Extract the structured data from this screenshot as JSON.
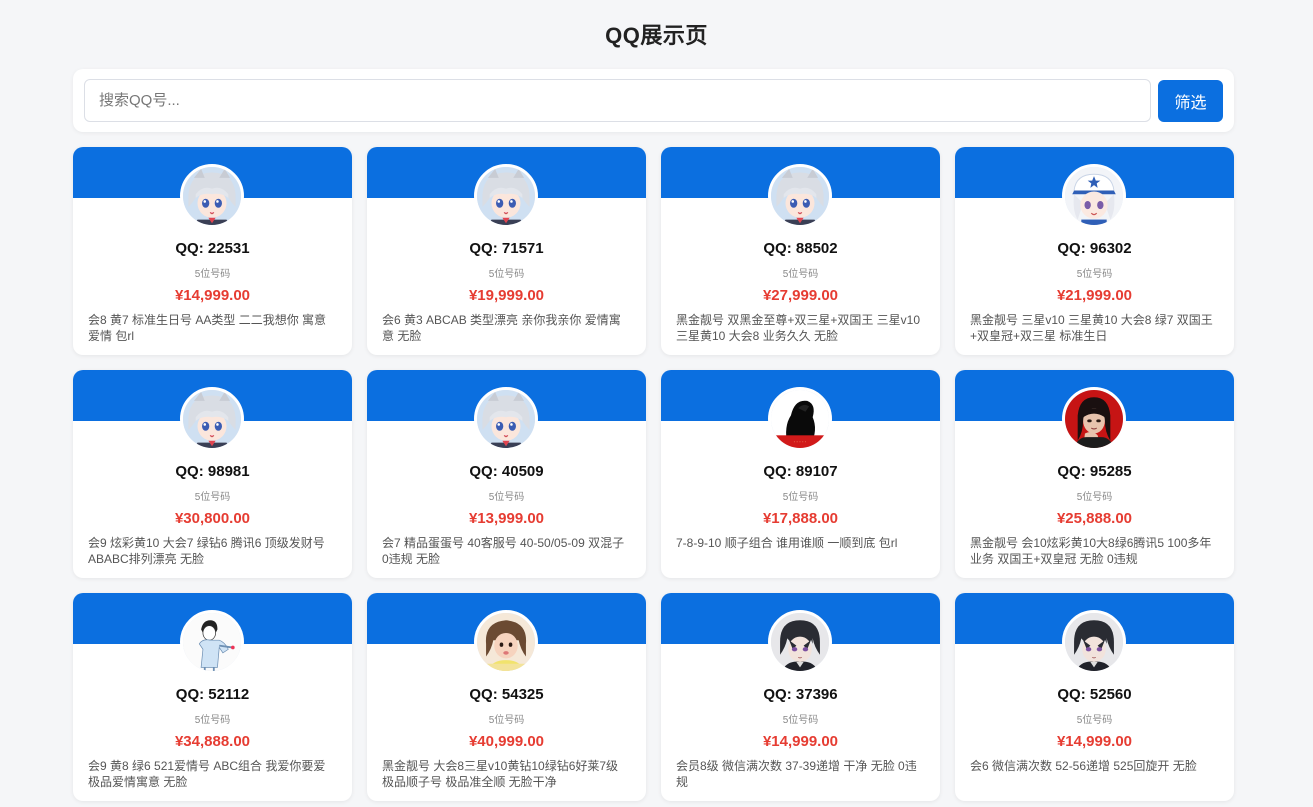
{
  "page": {
    "title": "QQ展示页"
  },
  "search": {
    "placeholder": "搜索QQ号...",
    "value": "",
    "button_label": "筛选"
  },
  "colors": {
    "accent": "#0b6fe0",
    "price": "#e63c32",
    "background": "#f5f6f8"
  },
  "cards": [
    {
      "qq": "QQ: 22531",
      "digits": "5位号码",
      "price": "¥14,999.00",
      "desc": "会8 黄7 标准生日号 AA类型 二二我想你 寓意爱情 包rl",
      "avatar": "anime-silver-hair"
    },
    {
      "qq": "QQ: 71571",
      "digits": "5位号码",
      "price": "¥19,999.00",
      "desc": "会6 黄3 ABCAB 类型漂亮 亲你我亲你 爱情寓意 无脸",
      "avatar": "anime-silver-hair"
    },
    {
      "qq": "QQ: 88502",
      "digits": "5位号码",
      "price": "¥27,999.00",
      "desc": "黑金靓号 双黑金至尊+双三星+双国王 三星v10 三星黄10 大会8 业务久久 无脸",
      "avatar": "anime-silver-hair"
    },
    {
      "qq": "QQ: 96302",
      "digits": "5位号码",
      "price": "¥21,999.00",
      "desc": "黑金靓号 三星v10 三星黄10 大会8 绿7 双国王 +双皇冠+双三星 标准生日",
      "avatar": "anime-cap-girl"
    },
    {
      "qq": "QQ: 98981",
      "digits": "5位号码",
      "price": "¥30,800.00",
      "desc": "会9 炫彩黄10 大会7 绿钻6 腾讯6 顶级发财号 ABABC排列漂亮 无脸",
      "avatar": "anime-silver-hair"
    },
    {
      "qq": "QQ: 40509",
      "digits": "5位号码",
      "price": "¥13,999.00",
      "desc": "会7 精品蛋蛋号 40客服号 40-50/05-09 双混子 0违规 无脸",
      "avatar": "anime-silver-hair"
    },
    {
      "qq": "QQ: 89107",
      "digits": "5位号码",
      "price": "¥17,888.00",
      "desc": "7-8-9-10 顺子组合 谁用谁顺 一顺到底 包rl",
      "avatar": "black-silhouette"
    },
    {
      "qq": "QQ: 95285",
      "digits": "5位号码",
      "price": "¥25,888.00",
      "desc": "黑金靓号 会10炫彩黄10大8绿6腾讯5 100多年业务 双国王+双皇冠 无脸 0违规",
      "avatar": "red-portrait"
    },
    {
      "qq": "QQ: 52112",
      "digits": "5位号码",
      "price": "¥34,888.00",
      "desc": "会9 黄8 绿6 521爱情号 ABC组合 我爱你要爱 极品爱情寓意 无脸",
      "avatar": "sketch-boy"
    },
    {
      "qq": "QQ: 54325",
      "digits": "5位号码",
      "price": "¥40,999.00",
      "desc": "黑金靓号 大会8三星v10黄钻10绿钻6好莱7级 极品顺子号 极品准全顺 无脸干净",
      "avatar": "little-girl"
    },
    {
      "qq": "QQ: 37396",
      "digits": "5位号码",
      "price": "¥14,999.00",
      "desc": "会员8级 微信满次数 37-39递增 干净 无脸 0违规",
      "avatar": "anime-dark-hair"
    },
    {
      "qq": "QQ: 52560",
      "digits": "5位号码",
      "price": "¥14,999.00",
      "desc": "会6 微信满次数 52-56递增 525回旋开 无脸",
      "avatar": "anime-dark-hair"
    }
  ]
}
